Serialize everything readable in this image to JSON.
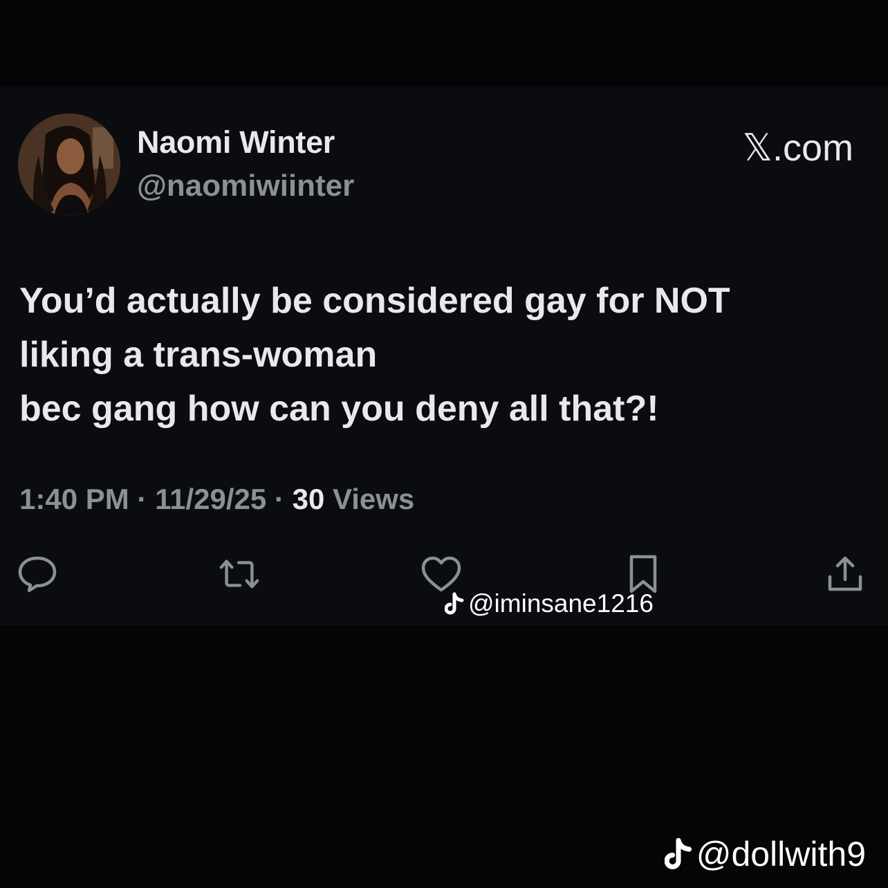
{
  "post": {
    "author_name": "Naomi Winter",
    "author_handle": "@naomiwiinter",
    "brand": "𝕏.com",
    "text_lines": [
      "You’d actually be considered gay for NOT",
      "liking a trans-woman",
      "bec gang how can you deny all that?!"
    ],
    "time": "1:40 PM",
    "separator": "·",
    "date": "11/29/25",
    "views_count": "30",
    "views_label": "Views"
  },
  "actions": {
    "reply_icon": "reply-icon",
    "repost_icon": "repost-icon",
    "like_icon": "heart-icon",
    "bookmark_icon": "bookmark-icon",
    "share_icon": "share-icon"
  },
  "watermarks": {
    "overlay_handle": "@iminsane1216",
    "corner_handle": "@dollwith9",
    "icon": "tiktok-note-icon"
  },
  "colors": {
    "background": "#050506",
    "card": "#0b0c10",
    "text_primary": "#e7e9ea",
    "text_secondary": "#8b9096"
  }
}
